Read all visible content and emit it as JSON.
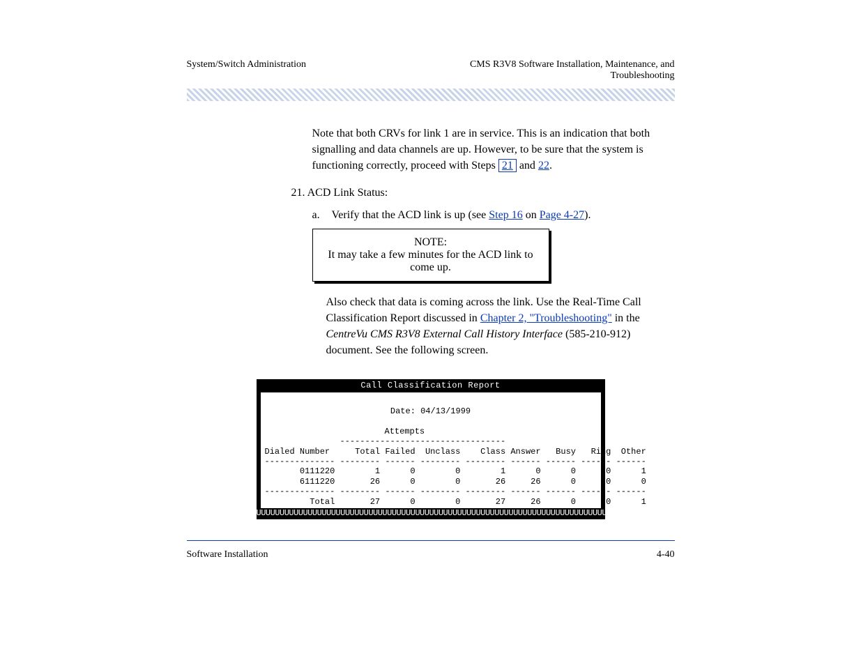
{
  "header": {
    "left": "System/Switch Administration",
    "right_label": "CMS R3V8 Software Installation, Maintenance, and\nTroubleshooting"
  },
  "intro_paragraph": "Note that both CRVs for link 1 are in service. This is an indication that both signalling and data channels are up. However, to be sure that the system is functioning correctly, proceed with Steps",
  "step_ref_1": "21",
  "intro_and": " and ",
  "step_ref_2": "22",
  "intro_period": ".",
  "section_label": "21. ACD Link Status:",
  "step_num": "a.",
  "step_text_before": "Verify that the ACD link is up (see ",
  "step_link": "Step 16",
  "step_text_after": " on ",
  "page_link": "Page 4-27",
  "step_text_end": ").",
  "note": {
    "label": "NOTE:",
    "text": "It may take a few minutes for the ACD link to come up."
  },
  "after_note_text_1": "Also check that data is coming across the link. Use the Real-Time Call Classification Report discussed in ",
  "after_note_chapter_title": "Chapter 2, \"Troubleshooting\"",
  "after_note_text_2": " in the ",
  "after_note_book_title": "CentreVu CMS R3V8 External Call History Interface",
  "after_note_text_3": " (585-210-912) document. See the following screen.",
  "terminal": {
    "title": "Call Classification Report",
    "date_line": "Date: 04/13/1999",
    "attempts_label": "Attempts",
    "columns": "Dialed Number     Total Failed  Unclass    Class Answer   Busy   Ring  Other",
    "sep": "-------------- -------- ------ -------- -------- ------ ------ ------ ------",
    "row1": "       0111220        1      0        0        1      0      0      0      1",
    "row2": "       6111220       26      0        0       26     26      0      0      0",
    "sep2": "-------------- -------- ------ -------- -------- ------ ------ ------ ------",
    "total": "         Total       27      0        0       27     26      0      0      1",
    "bottom_scroll": "UUUUUUUUUUUUUUUUUUUUUUUUUUUUUUUUUUUUUUUUUUUUUUUUUUUUUUUUUUUUUUUUUUUUUUUUUUUUUUUUUUUUUUUUUUUUUUU"
  },
  "chart_data": {
    "type": "table",
    "title": "Call Classification Report",
    "date": "04/13/1999",
    "columns": [
      "Dialed Number",
      "Total",
      "Failed",
      "Unclass",
      "Class",
      "Answer",
      "Busy",
      "Ring",
      "Other"
    ],
    "rows": [
      [
        "0111220",
        1,
        0,
        0,
        1,
        0,
        0,
        0,
        1
      ],
      [
        "6111220",
        26,
        0,
        0,
        26,
        26,
        0,
        0,
        0
      ]
    ],
    "total_row": [
      "Total",
      27,
      0,
      0,
      27,
      26,
      0,
      0,
      1
    ]
  },
  "footer": {
    "left": "Software Installation",
    "right": "4-40"
  }
}
